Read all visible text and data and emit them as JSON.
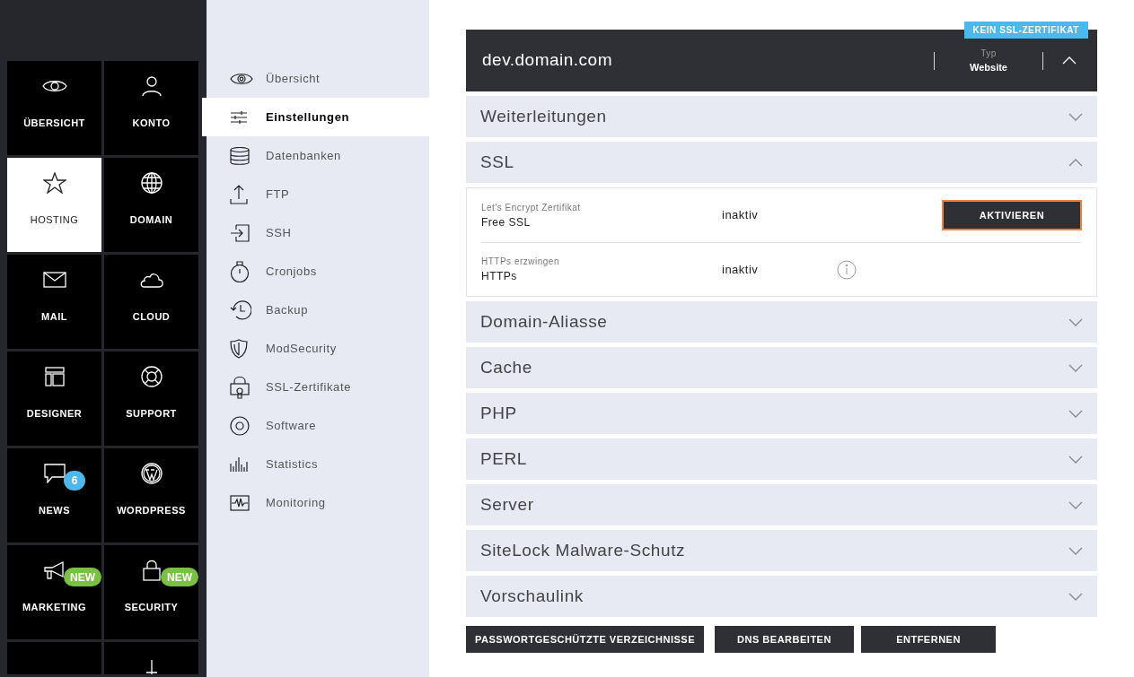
{
  "main_menu": {
    "tiles": [
      {
        "label": "ÜBERSICHT",
        "selected": false
      },
      {
        "label": "KONTO",
        "selected": false
      },
      {
        "label": "HOSTING",
        "selected": true
      },
      {
        "label": "DOMAIN",
        "selected": false
      },
      {
        "label": "MAIL",
        "selected": false
      },
      {
        "label": "CLOUD",
        "selected": false
      },
      {
        "label": "DESIGNER",
        "selected": false
      },
      {
        "label": "SUPPORT",
        "selected": false
      },
      {
        "label": "NEWS",
        "selected": false,
        "badge": {
          "kind": "count",
          "text": "6"
        }
      },
      {
        "label": "WORDPRESS",
        "selected": false
      },
      {
        "label": "MARKETING",
        "selected": false,
        "badge": {
          "kind": "new",
          "text": "NEW"
        }
      },
      {
        "label": "SECURITY",
        "selected": false,
        "badge": {
          "kind": "new",
          "text": "NEW"
        }
      }
    ]
  },
  "sub_menu": {
    "items": [
      {
        "label": "Übersicht",
        "selected": false
      },
      {
        "label": "Einstellungen",
        "selected": true
      },
      {
        "label": "Datenbanken",
        "selected": false
      },
      {
        "label": "FTP",
        "selected": false
      },
      {
        "label": "SSH",
        "selected": false
      },
      {
        "label": "Cronjobs",
        "selected": false
      },
      {
        "label": "Backup",
        "selected": false
      },
      {
        "label": "ModSecurity",
        "selected": false
      },
      {
        "label": "SSL-Zertifikate",
        "selected": false
      },
      {
        "label": "Software",
        "selected": false
      },
      {
        "label": "Statistics",
        "selected": false
      },
      {
        "label": "Monitoring",
        "selected": false
      }
    ]
  },
  "domain": {
    "badge": "KEIN SSL-ZERTIFIKAT",
    "name": "dev.domain.com",
    "type_label": "Typ",
    "type_value": "Website",
    "expanded": true
  },
  "sections": [
    {
      "title": "Weiterleitungen",
      "expanded": false
    },
    {
      "title": "SSL",
      "expanded": true,
      "rows": [
        {
          "caption": "Let's Encrypt Zertifikat",
          "label": "Free SSL",
          "status": "inaktiv",
          "info": false,
          "action": "AKTIVIEREN"
        },
        {
          "caption": "HTTPs erzwingen",
          "label": "HTTPs",
          "status": "inaktiv",
          "info": true
        }
      ]
    },
    {
      "title": "Domain-Aliasse",
      "expanded": false
    },
    {
      "title": "Cache",
      "expanded": false
    },
    {
      "title": "PHP",
      "expanded": false
    },
    {
      "title": "PERL",
      "expanded": false
    },
    {
      "title": "Server",
      "expanded": false
    },
    {
      "title": "SiteLock Malware-Schutz",
      "expanded": false
    },
    {
      "title": "Vorschaulink",
      "expanded": false
    }
  ],
  "buttons": [
    "PASSWORTGESCHÜTZTE VERZEICHNISSE",
    "DNS BEARBEITEN",
    "ENTFERNEN"
  ]
}
